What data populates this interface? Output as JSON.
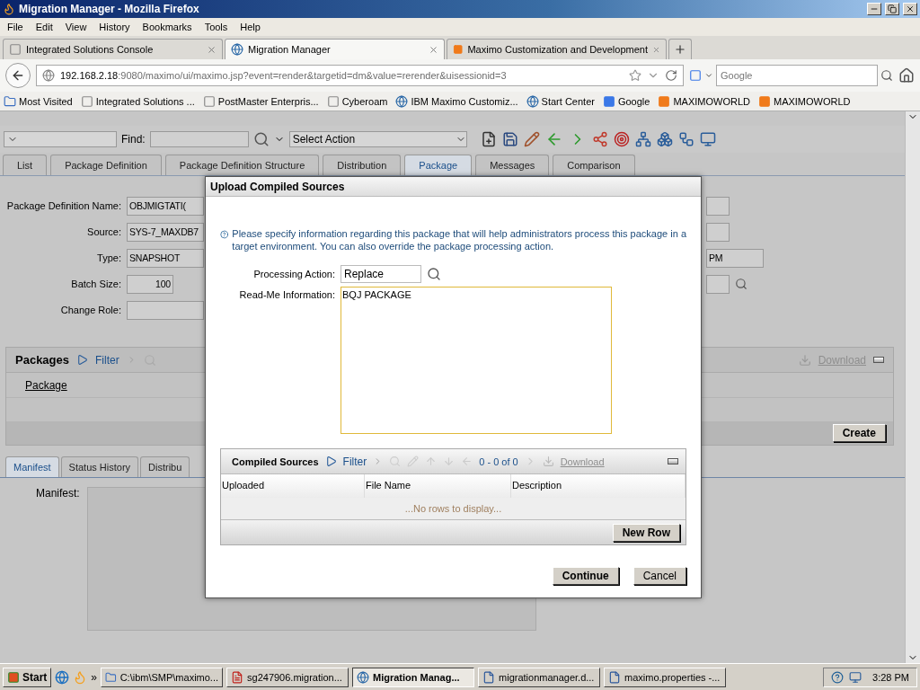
{
  "window": {
    "title": "Migration Manager - Mozilla Firefox"
  },
  "menu": [
    "File",
    "Edit",
    "View",
    "History",
    "Bookmarks",
    "Tools",
    "Help"
  ],
  "browser_tabs": [
    {
      "label": "Integrated Solutions Console",
      "selected": false
    },
    {
      "label": "Migration Manager",
      "selected": true
    },
    {
      "label": "Maximo Customization and Development",
      "selected": false
    }
  ],
  "address": {
    "host": "192.168.2.18",
    "path": ":9080/maximo/ui/maximo.jsp?event=render&targetid=dm&value=rerender&uisessionid=3"
  },
  "search": {
    "placeholder": "Google"
  },
  "bookmarks": [
    "Most Visited",
    "Integrated Solutions ...",
    "PostMaster Enterpris...",
    "Cyberoam",
    "IBM Maximo Customiz...",
    "Start Center",
    "Google",
    "MAXIMOWORLD",
    "MAXIMOWORLD"
  ],
  "app_toolbar": {
    "find_label": "Find:",
    "action_select": "Select Action"
  },
  "app_tabs": [
    {
      "label": "List",
      "selected": false
    },
    {
      "label": "Package Definition",
      "selected": false
    },
    {
      "label": "Package Definition Structure",
      "selected": false
    },
    {
      "label": "Distribution",
      "selected": false
    },
    {
      "label": "Package",
      "selected": true
    },
    {
      "label": "Messages",
      "selected": false
    },
    {
      "label": "Comparison",
      "selected": false
    }
  ],
  "form": {
    "rows": [
      {
        "label": "Package Definition Name:",
        "value": "OBJMIGTATI("
      },
      {
        "label": "Source:",
        "value": "SYS-7_MAXDB7"
      },
      {
        "label": "Type:",
        "value": "SNAPSHOT"
      },
      {
        "label": "Batch Size:",
        "value": "100"
      },
      {
        "label": "Change Role:"
      }
    ],
    "right_fields": [
      {
        "kind": "box"
      },
      {
        "kind": "box"
      },
      {
        "kind": "text",
        "value": "PM"
      },
      {
        "kind": "lookup"
      }
    ]
  },
  "packages": {
    "title": "Packages",
    "filter": "Filter",
    "download": {
      "label": "Download",
      "disabled": true
    },
    "columns": [
      "Package"
    ],
    "create": "Create"
  },
  "detail_tabs": [
    {
      "label": "Manifest",
      "selected": true
    },
    {
      "label": "Status History",
      "selected": false
    },
    {
      "label": "Distribu",
      "selected": false
    }
  ],
  "manifest": {
    "label": "Manifest:"
  },
  "dialog": {
    "title": "Upload Compiled Sources",
    "message": "Please specify information regarding this package that will help administrators process this package in a target environment. You can also override the package processing action.",
    "processing_action": {
      "label": "Processing Action:",
      "value": "Replace"
    },
    "readme": {
      "label": "Read-Me Information:",
      "value": "BQJ PACKAGE"
    },
    "table": {
      "title": "Compiled Sources",
      "filter": "Filter",
      "range": "0 - 0 of 0",
      "download": {
        "label": "Download",
        "disabled": true
      },
      "columns": [
        "Uploaded",
        "File Name",
        "Description"
      ],
      "empty": "...No rows to display...",
      "new_row": "New Row"
    },
    "buttons": [
      {
        "label": "Continue",
        "primary": true
      },
      {
        "label": "Cancel",
        "primary": false
      }
    ]
  },
  "taskbar": {
    "start": "Start",
    "more": "»",
    "items": [
      {
        "label": "C:\\ibm\\SMP\\maximo...",
        "selected": false
      },
      {
        "label": "sg247906.migration...",
        "selected": false
      },
      {
        "label": "Migration Manag...",
        "selected": true
      },
      {
        "label": "migrationmanager.d...",
        "selected": false
      },
      {
        "label": "maximo.properties -...",
        "selected": false
      }
    ],
    "clock": "3:28 PM"
  }
}
